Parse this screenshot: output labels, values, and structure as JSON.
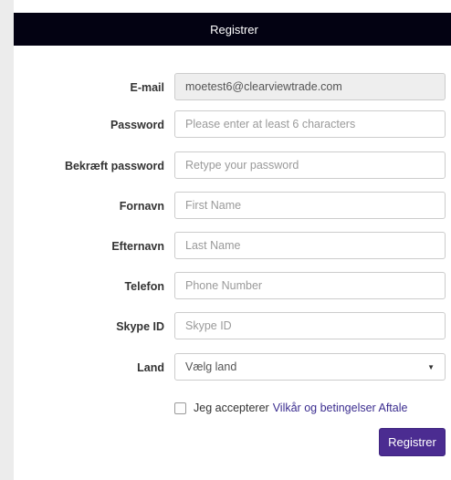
{
  "header": {
    "title": "Registrer"
  },
  "form": {
    "email": {
      "label": "E-mail",
      "value": "moetest6@clearviewtrade.com"
    },
    "password": {
      "label": "Password",
      "placeholder": "Please enter at least 6 characters"
    },
    "confirm_password": {
      "label": "Bekræft password",
      "placeholder": "Retype your password"
    },
    "first_name": {
      "label": "Fornavn",
      "placeholder": "First Name"
    },
    "last_name": {
      "label": "Efternavn",
      "placeholder": "Last Name"
    },
    "phone": {
      "label": "Telefon",
      "placeholder": "Phone Number"
    },
    "skype": {
      "label": "Skype ID",
      "placeholder": "Skype ID"
    },
    "country": {
      "label": "Land",
      "selected": "Vælg land",
      "caret": "▼"
    },
    "terms": {
      "prefix": "Jeg accepterer",
      "link": "Vilkår og betingelser Aftale",
      "checked": false
    },
    "submit_label": "Registrer"
  },
  "colors": {
    "header_bg": "#030212",
    "submit_bg": "#4b2c91",
    "link": "#3b2d8f"
  }
}
